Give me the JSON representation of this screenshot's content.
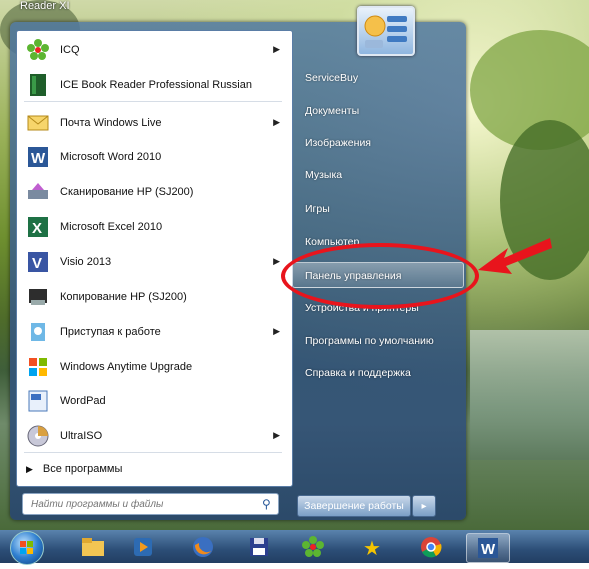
{
  "desktop": {
    "corner_label": "Reader XI"
  },
  "start_menu": {
    "programs": [
      {
        "label": "ICQ",
        "icon": "icq-flower-icon",
        "has_submenu": true
      },
      {
        "label": "ICE Book Reader Professional Russian",
        "icon": "ice-book-reader-icon",
        "has_submenu": false
      },
      {
        "label": "Почта Windows Live",
        "icon": "windows-live-mail-icon",
        "has_submenu": true
      },
      {
        "label": "Microsoft Word 2010",
        "icon": "word-icon",
        "has_submenu": false
      },
      {
        "label": "Сканирование HP (SJ200)",
        "icon": "hp-scan-icon",
        "has_submenu": false
      },
      {
        "label": "Microsoft Excel 2010",
        "icon": "excel-icon",
        "has_submenu": false
      },
      {
        "label": "Visio 2013",
        "icon": "visio-icon",
        "has_submenu": true
      },
      {
        "label": "Копирование HP (SJ200)",
        "icon": "hp-copy-icon",
        "has_submenu": false
      },
      {
        "label": "Приступая к работе",
        "icon": "getting-started-icon",
        "has_submenu": true
      },
      {
        "label": "Windows Anytime Upgrade",
        "icon": "windows-flag-icon",
        "has_submenu": false
      },
      {
        "label": "WordPad",
        "icon": "wordpad-icon",
        "has_submenu": false
      },
      {
        "label": "UltraISO",
        "icon": "ultraiso-disc-icon",
        "has_submenu": true
      }
    ],
    "all_programs": "Все программы",
    "search_placeholder": "Найти программы и файлы",
    "right_items": [
      "ServiceBuy",
      "Документы",
      "Изображения",
      "Музыка",
      "Игры",
      "Компьютер",
      "Панель управления",
      "Устройства и принтеры",
      "Программы по умолчанию",
      "Справка и поддержка"
    ],
    "highlighted_item": "Панель управления",
    "shutdown_label": "Завершение работы"
  },
  "taskbar": {
    "apps": [
      "windows-explorer-icon",
      "media-player-icon",
      "firefox-icon",
      "save-floppy-icon",
      "icq-flower-icon",
      "stars-icon",
      "chrome-icon",
      "word-icon"
    ],
    "active_app": "word-icon"
  },
  "colors": {
    "annotation": "#e8141c",
    "menu_blue": "#2f5d8c"
  }
}
